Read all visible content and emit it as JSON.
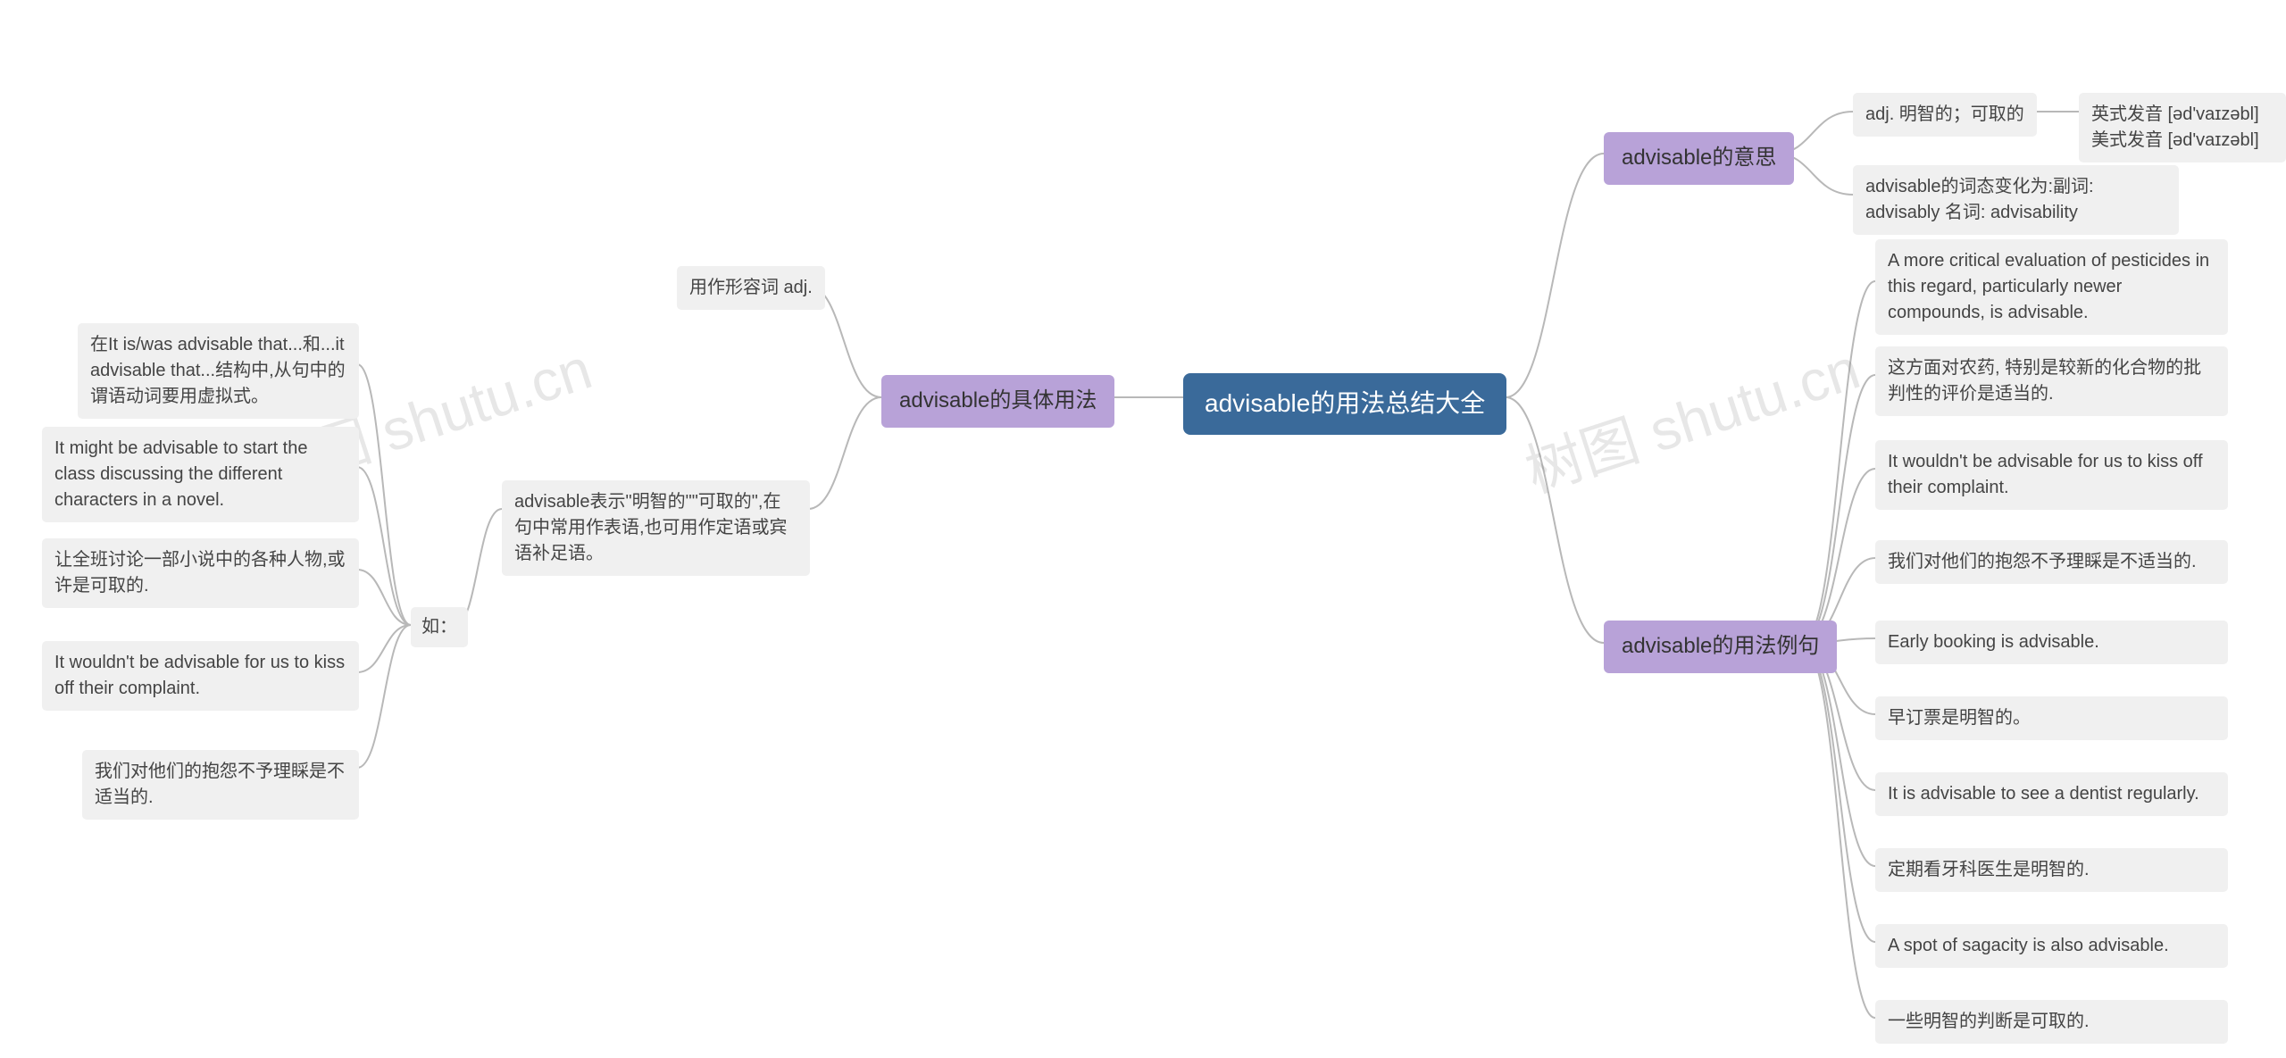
{
  "root": "advisable的用法总结大全",
  "watermark1": "树图 shutu.cn",
  "watermark2": "树图 shutu.cn",
  "right": {
    "meaning": {
      "label": "advisable的意思",
      "definition": "adj. 明智的；可取的",
      "pronunciation": "英式发音 [əd'vaɪzəbl] 美式发音 [əd'vaɪzəbl]",
      "forms": "advisable的词态变化为:副词: advisably 名词: advisability"
    },
    "examples": {
      "label": "advisable的用法例句",
      "items": [
        "A more critical evaluation of pesticides in this regard, particularly newer compounds, is advisable.",
        "这方面对农药, 特别是较新的化合物的批判性的评价是适当的.",
        "It wouldn't be advisable for us to kiss off their complaint.",
        "我们对他们的抱怨不予理睬是不适当的.",
        "Early booking is advisable.",
        "早订票是明智的。",
        "It is advisable to see a dentist regularly.",
        "定期看牙科医生是明智的.",
        "A spot of sagacity is also advisable.",
        "一些明智的判断是可取的."
      ]
    }
  },
  "left": {
    "usage": {
      "label": "advisable的具体用法",
      "as_adj": "用作形容词 adj.",
      "desc": "advisable表示\"明智的\"\"可取的\",在句中常用作表语,也可用作定语或宾语补足语。",
      "eg_label": "如：",
      "items": [
        "在It is/was advisable that...和...it advisable that...结构中,从句中的谓语动词要用虚拟式。",
        "It might be advisable to start the class discussing the different characters in a novel.",
        "让全班讨论一部小说中的各种人物,或许是可取的.",
        "It wouldn't be advisable for us to kiss off their complaint.",
        "我们对他们的抱怨不予理睬是不适当的."
      ]
    }
  }
}
